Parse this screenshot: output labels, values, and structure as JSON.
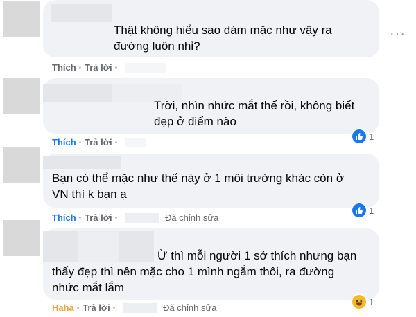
{
  "comments": [
    {
      "text": "Thật không hiểu sao dám mặc như vậy ra\nđường luôn nhỉ?",
      "like_label": "Thích",
      "reply_label": "Trả lời",
      "edited": "",
      "reaction_count": ""
    },
    {
      "text": "Trời, nhìn nhức mắt thế rồi, không biết\nđẹp ở điểm nào",
      "like_label": "Thích",
      "reply_label": "Trả lời",
      "edited": "",
      "reaction_count": "1"
    },
    {
      "text": "Bạn có thể mặc như thế này ở 1 môi trường khác còn ở\nVN thì k bạn ạ",
      "like_label": "Thích",
      "reply_label": "Trả lời",
      "edited": "Đã chỉnh sửa",
      "reaction_count": "1"
    },
    {
      "text": "Ừ thì mỗi người 1 sở thích nhưng bạn\nthấy đẹp thì nên mặc cho 1 mình ngắm thôi, ra đường\nnhức mắt lắm",
      "like_label": "Haha",
      "reply_label": "Trả lời",
      "edited": "Đã chỉnh sửa",
      "reaction_count": "1"
    }
  ],
  "more_button": "···",
  "colors": {
    "like_active": "#1877f2",
    "haha_active": "#f0a33c",
    "bubble_bg": "#f0f2f5"
  },
  "icons": {
    "like": "thumbs-up-icon",
    "haha": "laughing-face-icon",
    "more": "ellipsis-icon"
  }
}
